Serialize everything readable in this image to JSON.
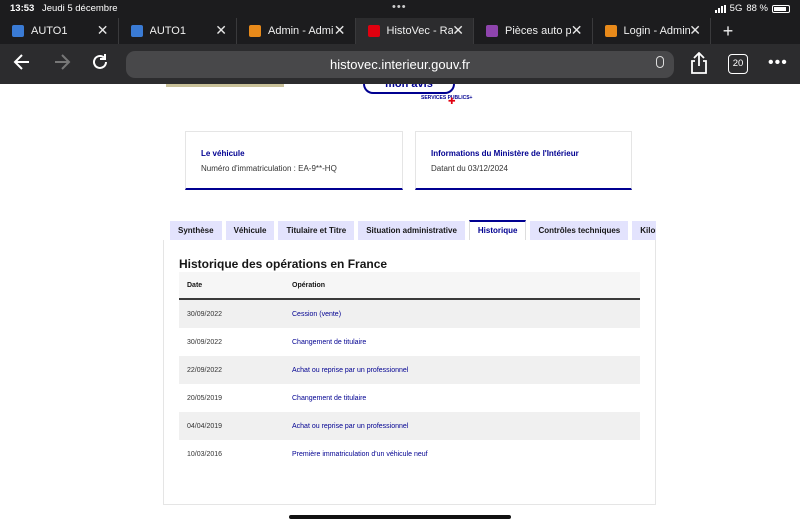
{
  "status": {
    "time": "13:53",
    "date": "Jeudi 5 décembre",
    "network": "5G",
    "battery": "88 %"
  },
  "tabs": [
    {
      "title": "AUTO1",
      "favicon_color": "#3a7bd5",
      "active": false
    },
    {
      "title": "AUTO1",
      "favicon_color": "#3a7bd5",
      "active": false
    },
    {
      "title": "Admin - Admin",
      "favicon_color": "#e88a1a",
      "active": false
    },
    {
      "title": "HistoVec - Rapport",
      "favicon_color": "#e1000f",
      "active": true
    },
    {
      "title": "Pièces auto pas",
      "favicon_color": "#8e44ad",
      "active": false
    },
    {
      "title": "Login - Admin",
      "favicon_color": "#e88a1a",
      "active": false
    }
  ],
  "toolbar": {
    "url": "histovec.interieur.gouv.fr",
    "tab_count": "20",
    "back_icon": "arrow-left-icon",
    "forward_icon": "arrow-right-icon",
    "reload_icon": "reload-icon",
    "share_icon": "share-icon",
    "more_icon": "more-icon"
  },
  "header": {
    "mon_avis": "mon avis",
    "services_publics": "SERVICES PUBLICS+"
  },
  "cards": [
    {
      "title": "Le véhicule",
      "value": "Numéro d'immatriculation : EA-9**-HQ"
    },
    {
      "title": "Informations du Ministère de l'Intérieur",
      "value": "Datant du 03/12/2024"
    }
  ],
  "nav_tabs": [
    {
      "label": "Synthèse",
      "active": false
    },
    {
      "label": "Véhicule",
      "active": false
    },
    {
      "label": "Titulaire et Titre",
      "active": false
    },
    {
      "label": "Situation administrative",
      "active": false
    },
    {
      "label": "Historique",
      "active": true
    },
    {
      "label": "Contrôles techniques",
      "active": false
    },
    {
      "label": "Kilométrage",
      "active": false
    }
  ],
  "history": {
    "title": "Historique des opérations en France",
    "headers": {
      "date": "Date",
      "operation": "Opération"
    },
    "rows": [
      {
        "date": "30/09/2022",
        "operation": "Cession (vente)"
      },
      {
        "date": "30/09/2022",
        "operation": "Changement de titulaire"
      },
      {
        "date": "22/09/2022",
        "operation": "Achat ou reprise par un professionnel"
      },
      {
        "date": "20/05/2019",
        "operation": "Changement de titulaire"
      },
      {
        "date": "04/04/2019",
        "operation": "Achat ou reprise par un professionnel"
      },
      {
        "date": "10/03/2016",
        "operation": "Première immatriculation d'un véhicule neuf"
      }
    ]
  },
  "colors": {
    "accent": "#000091",
    "chrome_dark": "#1c1c1e",
    "tab_inactive_bg": "#e3e3fd"
  }
}
